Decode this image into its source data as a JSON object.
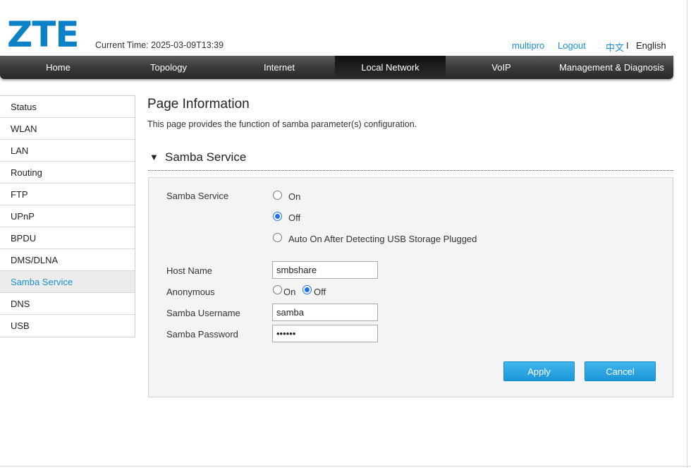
{
  "header": {
    "logo": "ZTE",
    "current_time": "Current Time: 2025-03-09T13:39",
    "username": "multipro",
    "logout": "Logout",
    "lang_zh": "中文",
    "lang_sep": "I",
    "lang_en": "English"
  },
  "nav": {
    "items": [
      "Home",
      "Topology",
      "Internet",
      "Local Network",
      "VoIP",
      "Management & Diagnosis"
    ],
    "active": "Local Network"
  },
  "sidebar": {
    "items": [
      "Status",
      "WLAN",
      "LAN",
      "Routing",
      "FTP",
      "UPnP",
      "BPDU",
      "DMS/DLNA",
      "Samba Service",
      "DNS",
      "USB"
    ],
    "active": "Samba Service"
  },
  "page": {
    "title": "Page Information",
    "description": "This page provides the function of samba parameter(s) configuration.",
    "section_title": "Samba Service",
    "section_toggle_icon": "triangle-down-icon"
  },
  "form": {
    "samba_service_label": "Samba Service",
    "samba_service_options": [
      "On",
      "Off",
      "Auto On After Detecting USB Storage Plugged"
    ],
    "samba_service_selected": "Off",
    "host_name_label": "Host Name",
    "host_name_value": "smbshare",
    "anonymous_label": "Anonymous",
    "anonymous_options": [
      "On",
      "Off"
    ],
    "anonymous_selected": "Off",
    "username_label": "Samba Username",
    "username_value": "samba",
    "password_label": "Samba Password",
    "password_value": "••••••",
    "apply": "Apply",
    "cancel": "Cancel"
  },
  "colors": {
    "brand": "#0b82c6",
    "link": "#1a8fd3",
    "button": "#1b96d8",
    "nav_bg": "#3a3a3a"
  }
}
